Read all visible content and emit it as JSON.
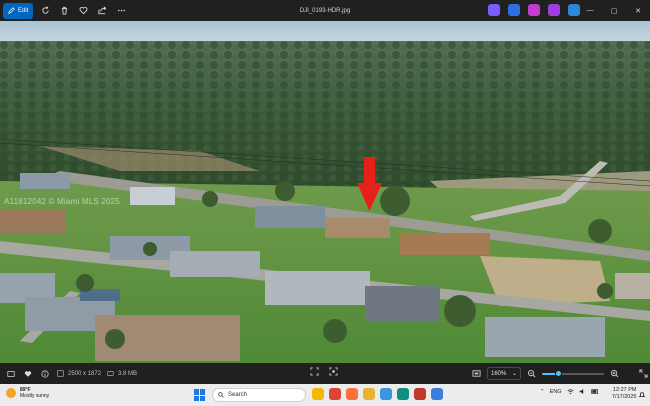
{
  "titlebar": {
    "edit_label": "Edit",
    "filename": "DJI_0193-HDR.jpg",
    "app_icons": [
      {
        "name": "copilot-icon",
        "color": "#7a5cff"
      },
      {
        "name": "designer-icon",
        "color": "#2f6fdf"
      },
      {
        "name": "clipchamp-icon",
        "color": "#c43bd1"
      },
      {
        "name": "photos-icon",
        "color": "#9c3ee0"
      },
      {
        "name": "onedrive-icon",
        "color": "#2b88d8"
      }
    ],
    "controls": {
      "minimize": "—",
      "maximize": "▢",
      "close": "✕"
    }
  },
  "photo": {
    "watermark": "A11812042 © Miami MLS 2025",
    "annotation": "red-arrow"
  },
  "infobar": {
    "dimensions": "2500 x 1872",
    "file_size": "3.8 MB",
    "zoom": "160%",
    "zoom_level": 0.27
  },
  "taskbar": {
    "weather_temp": "89°F",
    "weather_desc": "Mostly sunny",
    "search_placeholder": "Search",
    "language": "ENG",
    "time": "12:27 PM",
    "date": "7/17/2025",
    "apps": [
      {
        "name": "file-explorer-icon",
        "color": "#f2b900"
      },
      {
        "name": "chrome-icon",
        "color": "#db4437"
      },
      {
        "name": "firefox-icon",
        "color": "#ff7139"
      },
      {
        "name": "folder-icon",
        "color": "#e7b42f"
      },
      {
        "name": "store-icon",
        "color": "#3a96dd"
      },
      {
        "name": "edge-icon",
        "color": "#0f8f7f"
      },
      {
        "name": "mail-icon",
        "color": "#c0392b"
      },
      {
        "name": "photos-app-icon",
        "color": "#3b7ddd"
      }
    ]
  },
  "colors": {
    "accent": "#0067c0",
    "slider": "#4cc2ff",
    "arrow": "#e8201a"
  }
}
